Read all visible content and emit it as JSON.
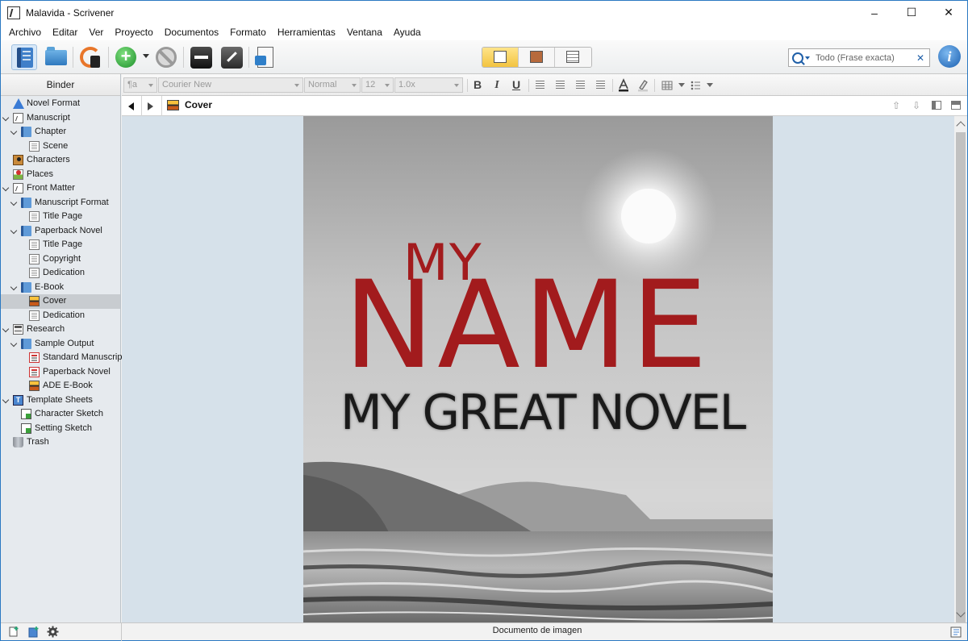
{
  "window": {
    "title": "Malavida - Scrivener",
    "controls": [
      "–",
      "☐",
      "✕"
    ]
  },
  "menu": [
    "Archivo",
    "Editar",
    "Ver",
    "Proyecto",
    "Documentos",
    "Formato",
    "Herramientas",
    "Ventana",
    "Ayuda"
  ],
  "search": {
    "placeholder": "Todo (Frase exacta)",
    "clear_glyph": "✕"
  },
  "info_glyph": "i",
  "binder": {
    "header": "Binder",
    "items": [
      {
        "label": "Novel Format",
        "icon": "warning-icon",
        "depth": 0,
        "expander": false
      },
      {
        "label": "Manuscript",
        "icon": "manuscript-icon",
        "depth": 0,
        "expander": true
      },
      {
        "label": "Chapter",
        "icon": "folder-icon",
        "depth": 1,
        "expander": true
      },
      {
        "label": "Scene",
        "icon": "document-icon",
        "depth": 2,
        "expander": false
      },
      {
        "label": "Characters",
        "icon": "characters-icon",
        "depth": 0,
        "expander": false
      },
      {
        "label": "Places",
        "icon": "places-icon",
        "depth": 0,
        "expander": false
      },
      {
        "label": "Front Matter",
        "icon": "front-matter-icon",
        "depth": 0,
        "expander": true
      },
      {
        "label": "Manuscript Format",
        "icon": "folder-icon",
        "depth": 1,
        "expander": true
      },
      {
        "label": "Title Page",
        "icon": "document-icon",
        "depth": 2,
        "expander": false
      },
      {
        "label": "Paperback Novel",
        "icon": "folder-icon",
        "depth": 1,
        "expander": true
      },
      {
        "label": "Title Page",
        "icon": "document-icon",
        "depth": 2,
        "expander": false
      },
      {
        "label": "Copyright",
        "icon": "document-icon",
        "depth": 2,
        "expander": false
      },
      {
        "label": "Dedication",
        "icon": "document-icon",
        "depth": 2,
        "expander": false
      },
      {
        "label": "E-Book",
        "icon": "folder-icon",
        "depth": 1,
        "expander": true
      },
      {
        "label": "Cover",
        "icon": "image-icon",
        "depth": 2,
        "expander": false,
        "selected": true
      },
      {
        "label": "Dedication",
        "icon": "document-icon",
        "depth": 2,
        "expander": false
      },
      {
        "label": "Research",
        "icon": "research-icon",
        "depth": 0,
        "expander": true
      },
      {
        "label": "Sample Output",
        "icon": "folder-icon",
        "depth": 1,
        "expander": true
      },
      {
        "label": "Standard Manuscript",
        "icon": "pdf-icon",
        "depth": 2,
        "expander": false
      },
      {
        "label": "Paperback Novel",
        "icon": "pdf-icon",
        "depth": 2,
        "expander": false
      },
      {
        "label": "ADE E-Book",
        "icon": "image-icon",
        "depth": 2,
        "expander": false
      },
      {
        "label": "Template Sheets",
        "icon": "template-icon",
        "depth": 0,
        "expander": true
      },
      {
        "label": "Character Sketch",
        "icon": "sheet-icon",
        "depth": 1,
        "expander": false
      },
      {
        "label": "Setting Sketch",
        "icon": "sheet-icon",
        "depth": 1,
        "expander": false
      },
      {
        "label": "Trash",
        "icon": "trash-icon",
        "depth": 0,
        "expander": false
      }
    ]
  },
  "format_bar": {
    "style": "¶a",
    "font": "Courier New",
    "typeface": "Normal",
    "size": "12",
    "spacing": "1.0x",
    "bold": "B",
    "italic": "I",
    "underline": "U"
  },
  "editor": {
    "doc_title": "Cover",
    "cover": {
      "line1": "MY",
      "line2": "NAME",
      "line3": "MY GREAT NOVEL"
    }
  },
  "status": {
    "text": "Documento de imagen"
  },
  "colors": {
    "title_red": "#a21b1d",
    "canvas_bg": "#d6e1ea",
    "binder_bg": "#e6eaee",
    "selected_row": "#c8ccd0",
    "accent_blue": "#2b79c2"
  }
}
